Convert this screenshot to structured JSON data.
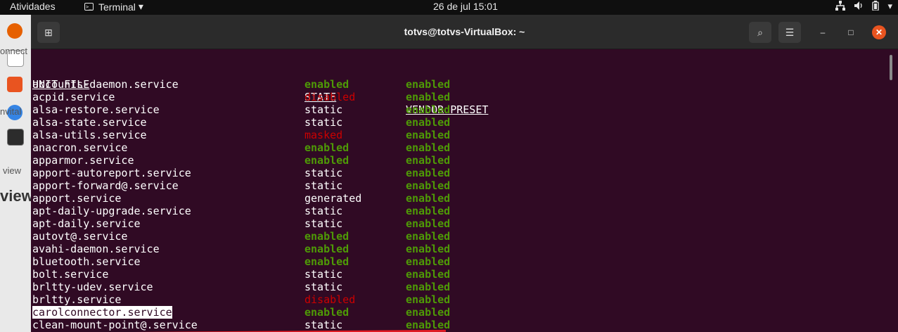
{
  "topbar": {
    "activities": "Atividades",
    "app_name": "Terminal",
    "app_caret": "▾",
    "clock": "26 de jul  15:01",
    "status_icons": [
      "network-icon",
      "volume-icon",
      "battery-icon",
      "system-menu-icon"
    ]
  },
  "dock": {
    "bg_texts": [
      "onnect",
      "nvital",
      "view",
      "view"
    ]
  },
  "window": {
    "title": "totvs@totvs-VirtualBox: ~",
    "new_tab_glyph": "⊞",
    "search_glyph": "⌕",
    "menu_glyph": "☰",
    "minimize_glyph": "–",
    "maximize_glyph": "□",
    "close_glyph": "✕"
  },
  "terminal": {
    "headers": {
      "unit_file": "UNIT FILE",
      "state": "STATE",
      "vendor_preset": "VENDOR PRESET"
    },
    "rows": [
      {
        "unit": "accounts-daemon.service",
        "state": "enabled",
        "vendor": "enabled"
      },
      {
        "unit": "acpid.service",
        "state": "disabled",
        "vendor": "enabled"
      },
      {
        "unit": "alsa-restore.service",
        "state": "static",
        "vendor": "enabled"
      },
      {
        "unit": "alsa-state.service",
        "state": "static",
        "vendor": "enabled"
      },
      {
        "unit": "alsa-utils.service",
        "state": "masked",
        "vendor": "enabled"
      },
      {
        "unit": "anacron.service",
        "state": "enabled",
        "vendor": "enabled"
      },
      {
        "unit": "apparmor.service",
        "state": "enabled",
        "vendor": "enabled"
      },
      {
        "unit": "apport-autoreport.service",
        "state": "static",
        "vendor": "enabled"
      },
      {
        "unit": "apport-forward@.service",
        "state": "static",
        "vendor": "enabled"
      },
      {
        "unit": "apport.service",
        "state": "generated",
        "vendor": "enabled"
      },
      {
        "unit": "apt-daily-upgrade.service",
        "state": "static",
        "vendor": "enabled"
      },
      {
        "unit": "apt-daily.service",
        "state": "static",
        "vendor": "enabled"
      },
      {
        "unit": "autovt@.service",
        "state": "enabled",
        "vendor": "enabled"
      },
      {
        "unit": "avahi-daemon.service",
        "state": "enabled",
        "vendor": "enabled"
      },
      {
        "unit": "bluetooth.service",
        "state": "enabled",
        "vendor": "enabled"
      },
      {
        "unit": "bolt.service",
        "state": "static",
        "vendor": "enabled"
      },
      {
        "unit": "brltty-udev.service",
        "state": "static",
        "vendor": "enabled"
      },
      {
        "unit": "brltty.service",
        "state": "disabled",
        "vendor": "enabled"
      },
      {
        "unit": "carolconnector.service",
        "state": "enabled",
        "vendor": "enabled",
        "highlighted": true
      },
      {
        "unit": "clean-mount-point@.service",
        "state": "static",
        "vendor": "enabled"
      }
    ]
  },
  "colors": {
    "terminal_bg": "#300a24",
    "enabled": "#4e9a06",
    "disabled": "#cc0000",
    "close_button": "#e95420",
    "annotation_line": "#e01b24"
  }
}
